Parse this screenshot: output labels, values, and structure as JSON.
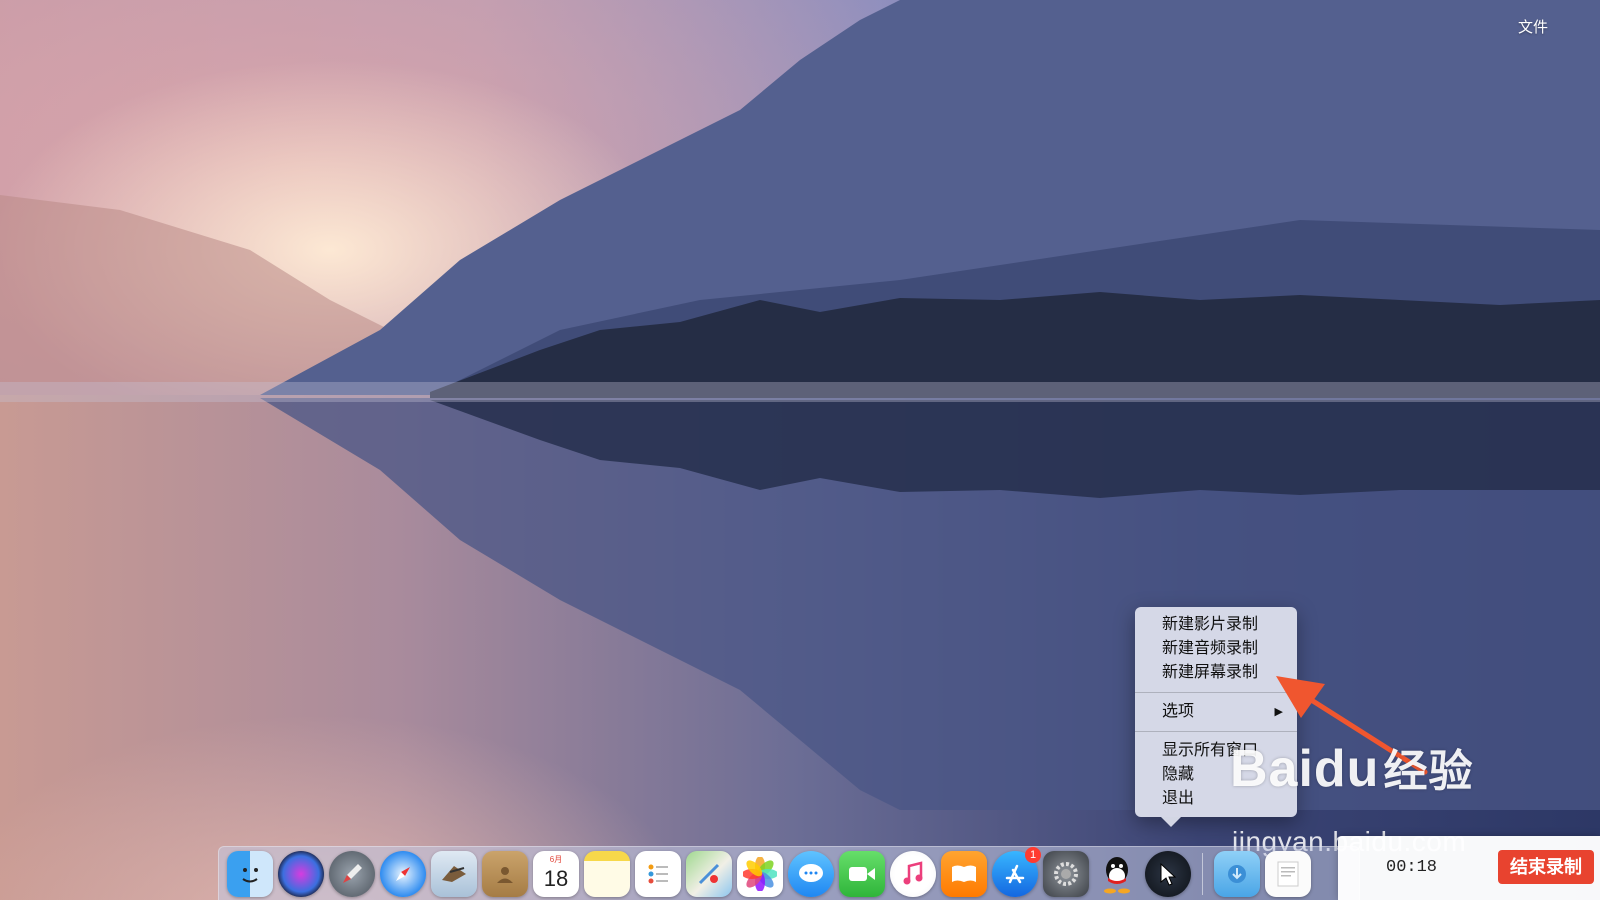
{
  "menu_bar": {
    "file_menu": "文件"
  },
  "context_menu": {
    "items": [
      {
        "label": "新建影片录制"
      },
      {
        "label": "新建音频录制"
      },
      {
        "label": "新建屏幕录制"
      },
      {
        "label": "选项",
        "submenu_arrow": "▶"
      },
      {
        "label": "显示所有窗口"
      },
      {
        "label": "隐藏"
      },
      {
        "label": "退出"
      }
    ]
  },
  "dock": {
    "calendar": {
      "month": "6月",
      "day": "18"
    },
    "app_store_badge": "1",
    "icons": [
      "finder-icon",
      "siri-icon",
      "launchpad-icon",
      "safari-icon",
      "mail-icon",
      "contacts-icon",
      "calendar-icon",
      "notes-icon",
      "reminders-icon",
      "maps-icon",
      "photos-icon",
      "messages-icon",
      "facetime-icon",
      "itunes-icon",
      "ibooks-icon",
      "app-store-icon",
      "system-preferences-icon",
      "qq-icon",
      "quicktime-icon",
      "downloads-folder-icon",
      "document-stack-icon"
    ]
  },
  "recording": {
    "elapsed": "00:18",
    "stop_label": "结束录制"
  },
  "watermark": {
    "brand_a": "Bai",
    "brand_b": "du",
    "brand_cn": "经验",
    "url": "jingyan.baidu.com"
  },
  "colors": {
    "annotation_arrow": "#f0562f",
    "stop_button": "#e8432f"
  }
}
